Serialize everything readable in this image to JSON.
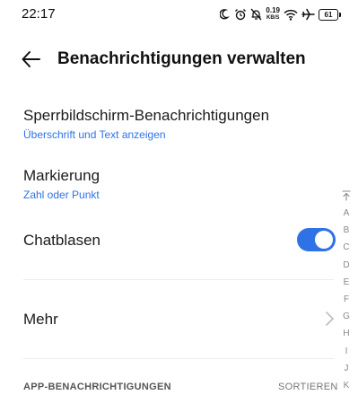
{
  "status_bar": {
    "time": "22:17",
    "net_speed_value": "0.19",
    "net_speed_unit": "KB/S",
    "battery": "61",
    "icons": [
      "moon-icon",
      "alarm-icon",
      "bell-off-icon",
      "wifi-icon",
      "airplane-icon",
      "battery-icon"
    ]
  },
  "header": {
    "title": "Benachrichtigungen verwalten",
    "back_icon": "arrow-left-icon"
  },
  "settings": {
    "lockscreen": {
      "label": "Sperrbildschirm-Benachrichtigungen",
      "value": "Überschrift und Text anzeigen"
    },
    "badge": {
      "label": "Markierung",
      "value": "Zahl oder Punkt"
    },
    "bubbles": {
      "label": "Chatblasen",
      "enabled": true
    },
    "more": {
      "label": "Mehr"
    }
  },
  "app_section": {
    "header": "APP-BENACHRICHTIGUNGEN",
    "sort_label": "SORTIEREN"
  },
  "index_bar": {
    "letters": [
      "A",
      "B",
      "C",
      "D",
      "E",
      "F",
      "G",
      "H",
      "I",
      "J",
      "K"
    ]
  },
  "colors": {
    "accent": "#2f72e6",
    "text": "#1b1b1b",
    "divider": "#ececec"
  }
}
